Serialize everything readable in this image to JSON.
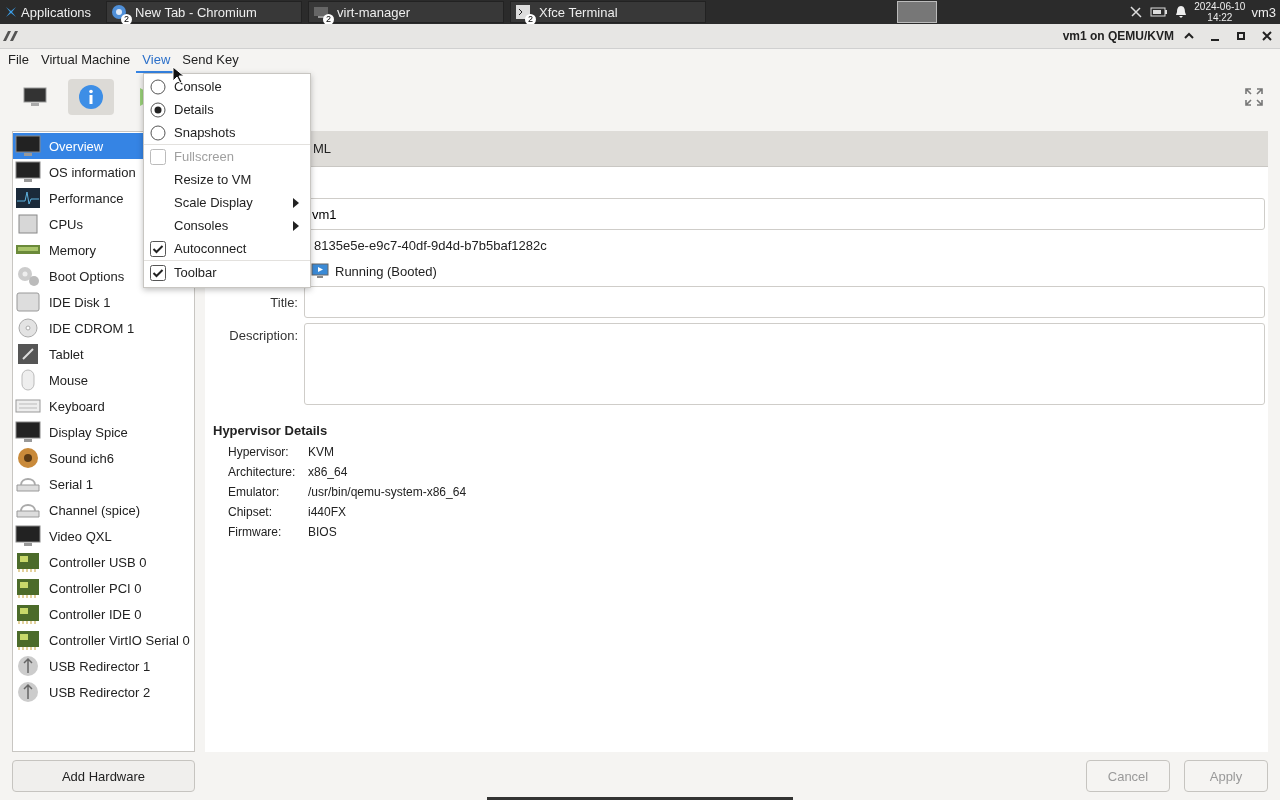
{
  "taskbar": {
    "apps_label": "Applications",
    "tasks": [
      {
        "title": "New Tab - Chromium",
        "badge": "2",
        "kind": "browser",
        "selected": false
      },
      {
        "title": "virt-manager",
        "badge": "2",
        "kind": "vm",
        "selected": false
      },
      {
        "title": "Xfce Terminal",
        "badge": "2",
        "kind": "terminal",
        "selected": false
      }
    ],
    "date": "2024-06-10",
    "time": "14:22",
    "user": "vm3"
  },
  "window": {
    "title": "vm1 on QEMU/KVM"
  },
  "menubar": [
    {
      "label": "File",
      "selected": false
    },
    {
      "label": "Virtual Machine",
      "selected": false
    },
    {
      "label": "View",
      "selected": true
    },
    {
      "label": "Send Key",
      "selected": false
    }
  ],
  "toolbar": [
    {
      "kind": "console",
      "selected": false
    },
    {
      "kind": "details",
      "selected": true
    },
    {
      "kind": "run",
      "selected": false
    }
  ],
  "sidebar": [
    {
      "label": "Overview",
      "kind": "monitor",
      "selected": true
    },
    {
      "label": "OS information",
      "kind": "monitor",
      "selected": false
    },
    {
      "label": "Performance",
      "kind": "graph",
      "selected": false
    },
    {
      "label": "CPUs",
      "kind": "chip",
      "selected": false
    },
    {
      "label": "Memory",
      "kind": "memory",
      "selected": false
    },
    {
      "label": "Boot Options",
      "kind": "gear",
      "selected": false
    },
    {
      "label": "IDE Disk 1",
      "kind": "disk",
      "selected": false
    },
    {
      "label": "IDE CDROM 1",
      "kind": "cdrom",
      "selected": false
    },
    {
      "label": "Tablet",
      "kind": "tablet",
      "selected": false
    },
    {
      "label": "Mouse",
      "kind": "mouse",
      "selected": false
    },
    {
      "label": "Keyboard",
      "kind": "keyboard",
      "selected": false
    },
    {
      "label": "Display Spice",
      "kind": "monitor",
      "selected": false
    },
    {
      "label": "Sound ich6",
      "kind": "speaker",
      "selected": false
    },
    {
      "label": "Serial 1",
      "kind": "serial",
      "selected": false
    },
    {
      "label": "Channel (spice)",
      "kind": "serial",
      "selected": false
    },
    {
      "label": "Video QXL",
      "kind": "monitor",
      "selected": false
    },
    {
      "label": "Controller USB 0",
      "kind": "card",
      "selected": false
    },
    {
      "label": "Controller PCI 0",
      "kind": "card",
      "selected": false
    },
    {
      "label": "Controller IDE 0",
      "kind": "card",
      "selected": false
    },
    {
      "label": "Controller VirtIO Serial 0",
      "kind": "card",
      "selected": false
    },
    {
      "label": "USB Redirector 1",
      "kind": "usb",
      "selected": false
    },
    {
      "label": "USB Redirector 2",
      "kind": "usb",
      "selected": false
    }
  ],
  "add_hardware": "Add Hardware",
  "tabs": [
    {
      "label": "ML"
    }
  ],
  "overview": {
    "name_value": "vm1",
    "uuid": "8135e5e-e9c7-40df-9d4d-b7b5baf1282c",
    "status": "Running (Booted)",
    "title_label": "Title:",
    "description_label": "Description:"
  },
  "hypervisor": {
    "heading": "Hypervisor Details",
    "rows": [
      {
        "label": "Hypervisor:",
        "value": "KVM"
      },
      {
        "label": "Architecture:",
        "value": "x86_64"
      },
      {
        "label": "Emulator:",
        "value": "/usr/bin/qemu-system-x86_64"
      },
      {
        "label": "Chipset:",
        "value": "i440FX"
      },
      {
        "label": "Firmware:",
        "value": "BIOS"
      }
    ]
  },
  "buttons": [
    {
      "label": "Cancel",
      "disabled": true
    },
    {
      "label": "Apply",
      "disabled": true
    }
  ],
  "view_menu": [
    {
      "label": "Console",
      "kind": "radio",
      "selected": false,
      "disabled": false,
      "separator_before": false
    },
    {
      "label": "Details",
      "kind": "radio",
      "selected": true,
      "disabled": false,
      "separator_before": false
    },
    {
      "label": "Snapshots",
      "kind": "radio",
      "selected": false,
      "disabled": false,
      "separator_before": false
    },
    {
      "label": "Fullscreen",
      "kind": "check",
      "checked": false,
      "disabled": true,
      "separator_before": true
    },
    {
      "label": "Resize to VM",
      "kind": "plain",
      "disabled": false,
      "separator_before": false
    },
    {
      "label": "Scale Display",
      "kind": "submenu",
      "disabled": false,
      "separator_before": false
    },
    {
      "label": "Consoles",
      "kind": "submenu",
      "disabled": false,
      "separator_before": false
    },
    {
      "label": "Autoconnect",
      "kind": "check",
      "checked": true,
      "disabled": false,
      "separator_before": false
    },
    {
      "label": "Toolbar",
      "kind": "check",
      "checked": true,
      "disabled": false,
      "separator_before": true
    }
  ]
}
